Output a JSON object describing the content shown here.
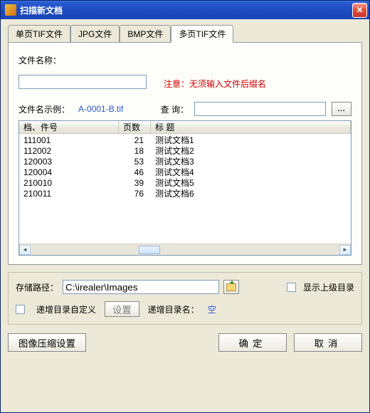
{
  "window": {
    "title": "扫描新文档"
  },
  "tabs": [
    {
      "label": "单页TIF文件"
    },
    {
      "label": "JPG文件"
    },
    {
      "label": "BMP文件"
    },
    {
      "label": "多页TIF文件"
    }
  ],
  "active_tab": 3,
  "filename": {
    "label": "文件名称：",
    "value": "",
    "warning": "注意：无须输入文件后缀名",
    "example_label": "文件名示例：",
    "example_value": "A-0001-B.tif"
  },
  "query": {
    "label": "查 询：",
    "value": "",
    "browse_label": "..."
  },
  "listview": {
    "columns": [
      {
        "label": "档、件号"
      },
      {
        "label": "页数"
      },
      {
        "label": "标 题"
      }
    ],
    "rows": [
      {
        "id": "111001",
        "pages": 21,
        "title": "测试文档1"
      },
      {
        "id": "112002",
        "pages": 18,
        "title": "测试文档2"
      },
      {
        "id": "120003",
        "pages": 53,
        "title": "测试文档3"
      },
      {
        "id": "120004",
        "pages": 46,
        "title": "测试文档4"
      },
      {
        "id": "210010",
        "pages": 39,
        "title": "测试文档5"
      },
      {
        "id": "210011",
        "pages": 76,
        "title": "测试文档6"
      }
    ]
  },
  "storage": {
    "label": "存储路径：",
    "value": "C:\\irealer\\Images",
    "show_parent_label": "显示上级目录",
    "show_parent_checked": false
  },
  "incremental": {
    "custom_label": "递增目录自定义",
    "custom_checked": false,
    "set_button": "设置",
    "name_label": "递增目录名：",
    "name_value": "空"
  },
  "buttons": {
    "compress": "图像压缩设置",
    "ok": "确定",
    "cancel": "取消"
  }
}
